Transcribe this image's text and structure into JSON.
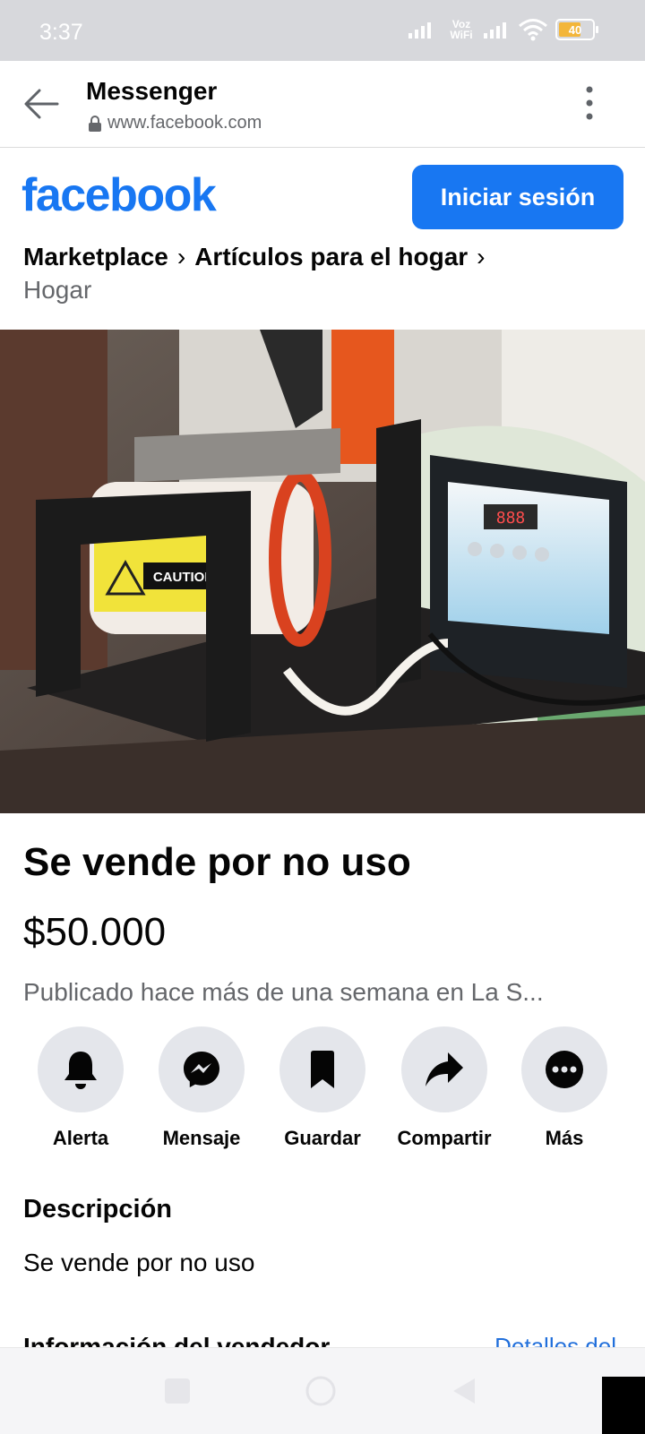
{
  "status_bar": {
    "time": "3:37",
    "network": "Voz WiFi",
    "battery": "40"
  },
  "browser": {
    "title": "Messenger",
    "url": "www.facebook.com"
  },
  "fb": {
    "logo": "facebook",
    "login_label": "Iniciar sesión",
    "brand_color": "#1877f2"
  },
  "breadcrumb": {
    "items": [
      "Marketplace",
      "Artículos para el hogar",
      "Hogar"
    ],
    "separator": "›"
  },
  "listing": {
    "image_text": "CAUTION",
    "title": "Se vende por no uso",
    "price": "$50.000",
    "published": "Publicado hace más de una semana en La S..."
  },
  "actions": [
    {
      "label": "Alerta",
      "icon": "bell-icon"
    },
    {
      "label": "Mensaje",
      "icon": "messenger-icon"
    },
    {
      "label": "Guardar",
      "icon": "bookmark-icon"
    },
    {
      "label": "Compartir",
      "icon": "share-icon"
    },
    {
      "label": "Más",
      "icon": "more-icon"
    }
  ],
  "description": {
    "heading": "Descripción",
    "text": "Se vende por no uso"
  },
  "seller": {
    "heading": "Información del vendedor",
    "link": "Detalles del"
  }
}
